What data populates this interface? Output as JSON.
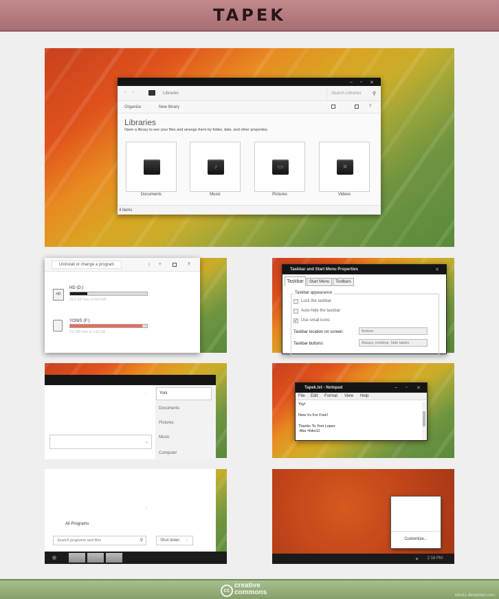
{
  "header": {
    "title": "TAPEK"
  },
  "footer": {
    "cc_logo": "cc",
    "cc_line1": "creative",
    "cc_line2": "commons",
    "credit": "kiko11.deviantart.com"
  },
  "explorer": {
    "address": "Libraries",
    "search_placeholder": "Search Libraries",
    "toolbar": {
      "organize": "Organize",
      "new_library": "New library"
    },
    "heading": "Libraries",
    "description": "Open a library to see your files and arrange them by folder, date, and other properties.",
    "libraries": [
      {
        "label": "Documents",
        "icon": "documents-folder-icon",
        "glyph": ""
      },
      {
        "label": "Music",
        "icon": "music-folder-icon",
        "glyph": "♪"
      },
      {
        "label": "Pictures",
        "icon": "pictures-folder-icon",
        "glyph": "▭"
      },
      {
        "label": "Videos",
        "icon": "videos-folder-icon",
        "glyph": "≡"
      }
    ],
    "status": "4 items"
  },
  "computer": {
    "uninstall_button": "Uninstall or change a program",
    "drives": [
      {
        "name": "HD (D:)",
        "icon_text": "HD",
        "free": "15.5 GB free of 59.9 GB",
        "used": 0.22,
        "color": "#1a1a1a"
      },
      {
        "name": "YONIS (F:)",
        "free": "211 MB free of 1.92 GB",
        "used": 0.94,
        "color": "#e86a5a"
      }
    ]
  },
  "taskbar_props": {
    "title": "Taskbar and Start Menu Properties",
    "tabs": [
      "Taskbar",
      "Start Menu",
      "Toolbars"
    ],
    "group_label": "Taskbar appearance",
    "checkboxes": [
      {
        "label": "Lock the taskbar",
        "checked": false
      },
      {
        "label": "Auto-hide the taskbar",
        "checked": false
      },
      {
        "label": "Use small icons",
        "checked": true
      }
    ],
    "location_label": "Taskbar location on screen:",
    "location_value": "Bottom",
    "buttons_label": "Taskbar buttons:",
    "buttons_value": "Always combine, hide labels"
  },
  "start_menu": {
    "user": "Yoni",
    "items": [
      "Documents",
      "Pictures",
      "Music",
      "Computer"
    ],
    "all_programs": "All Programs",
    "search_placeholder": "Search programs and files",
    "shutdown": "Shut down"
  },
  "notepad": {
    "title": "Tapek.txt - Notepad",
    "menu": [
      "File",
      "Edit",
      "Format",
      "View",
      "Help"
    ],
    "lines": [
      "Yay!",
      "",
      "New Vs For Free!",
      "",
      "Thanks To Yoni Lopez",
      "-Aka =kiko11"
    ]
  },
  "notification": {
    "customize": "Customize...",
    "time": "2:18 PM"
  },
  "colors": {
    "header": "#b07a7d",
    "footer": "#98b07b",
    "window_title": "#141414"
  }
}
